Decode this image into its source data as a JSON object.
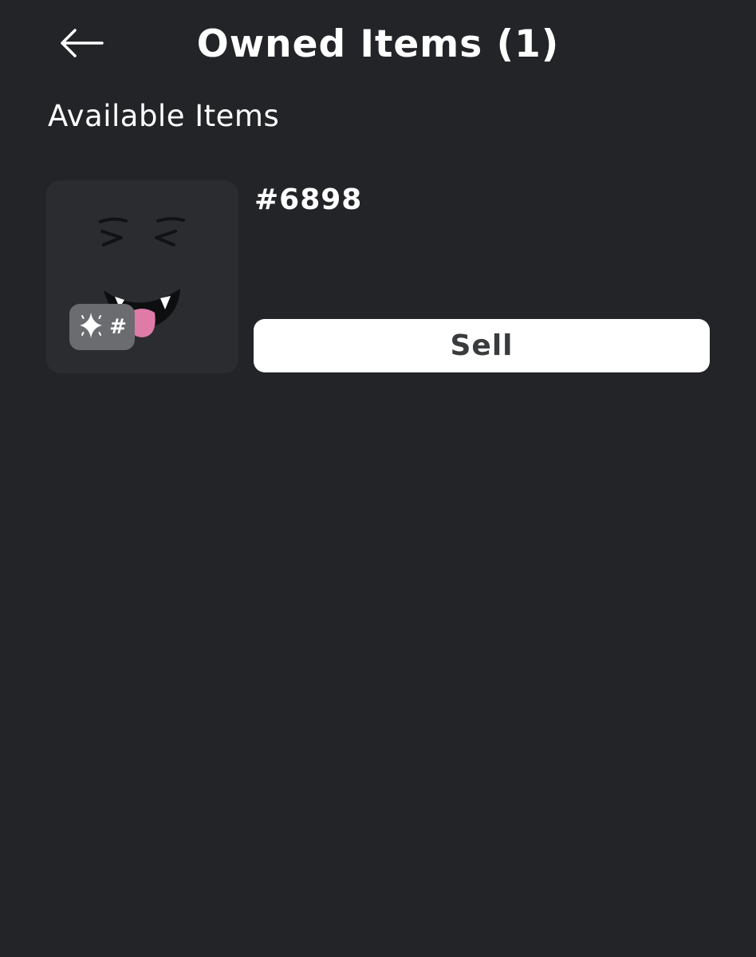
{
  "header": {
    "title": "Owned Items (1)",
    "back_icon": "arrow-left-icon"
  },
  "section": {
    "title": "Available Items"
  },
  "items": [
    {
      "name": "#6898",
      "thumbnail_icon": "winking-vampire-face-icon",
      "badge": {
        "icon": "sparkles-icon",
        "text": "#"
      },
      "sell_label": "Sell"
    }
  ],
  "colors": {
    "background": "#232427",
    "thumbnail_background": "#2b2c30",
    "badge_background": "#6b6c70",
    "button_background": "#ffffff",
    "button_text": "#393b3d",
    "tongue": "#e07aa6"
  }
}
